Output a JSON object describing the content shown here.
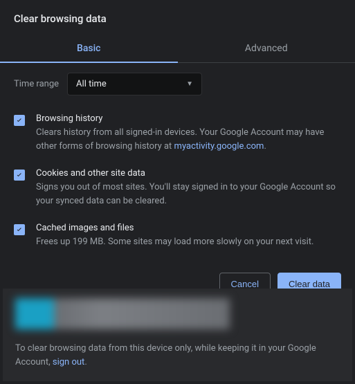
{
  "title": "Clear browsing data",
  "tabs": {
    "basic": "Basic",
    "advanced": "Advanced"
  },
  "timerange": {
    "label": "Time range",
    "value": "All time"
  },
  "options": {
    "history": {
      "title": "Browsing history",
      "desc_pre": "Clears history from all signed-in devices. Your Google Account may have other forms of browsing history at ",
      "link": "myactivity.google.com",
      "desc_post": "."
    },
    "cookies": {
      "title": "Cookies and other site data",
      "desc": "Signs you out of most sites. You'll stay signed in to your Google Account so your synced data can be cleared."
    },
    "cache": {
      "title": "Cached images and files",
      "desc": "Frees up 199 MB. Some sites may load more slowly on your next visit."
    }
  },
  "buttons": {
    "cancel": "Cancel",
    "clear": "Clear data"
  },
  "footer": {
    "text_pre": "To clear browsing data from this device only, while keeping it in your Google Account, ",
    "link": "sign out",
    "text_post": "."
  }
}
